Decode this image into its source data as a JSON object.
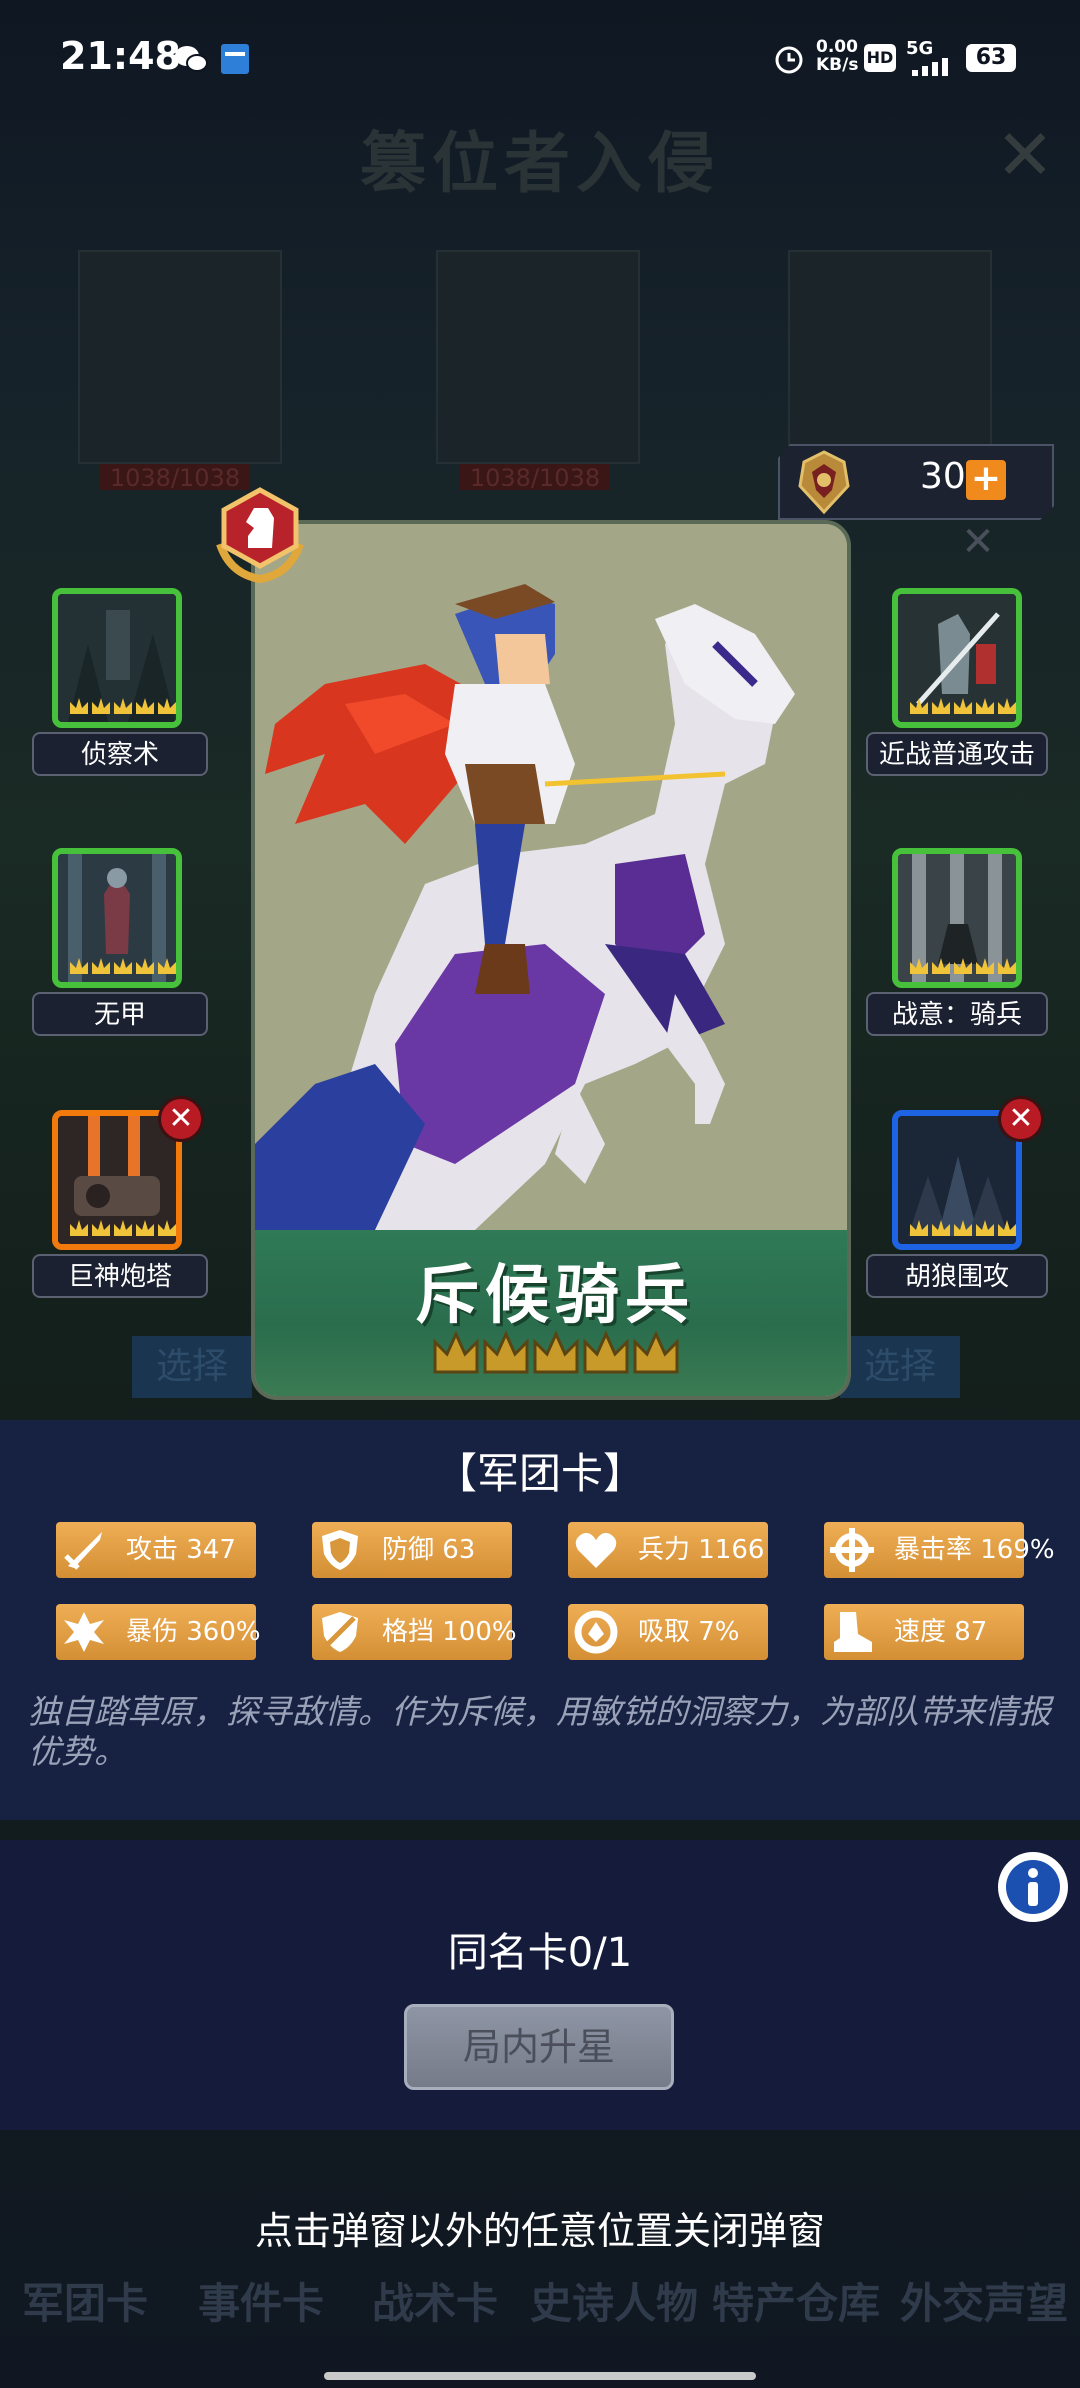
{
  "status_bar": {
    "time": "21:48",
    "net_speed_value": "0.00",
    "net_speed_unit": "KB/s",
    "hd_label": "HD",
    "network": "5G",
    "battery": "63"
  },
  "background": {
    "title": "篡位者入侵",
    "troop_hp_1": "1038/1038",
    "troop_hp_2": "1038/1038",
    "select_label": "选择",
    "hint_text": "点击弹窗以外的任意位置关闭弹窗",
    "bottom_tabs": [
      "军团卡",
      "事件卡",
      "战术卡",
      "史诗人物",
      "特产仓库",
      "外交声望"
    ]
  },
  "currency": {
    "amount": "30"
  },
  "card": {
    "name": "斥候骑兵",
    "stars": 5
  },
  "skills_left": [
    {
      "label": "侦察术",
      "frame": "green",
      "crowns": 5
    },
    {
      "label": "无甲",
      "frame": "green",
      "crowns": 5
    },
    {
      "label": "巨神炮塔",
      "frame": "orange",
      "crowns": 5
    }
  ],
  "skills_right": [
    {
      "label": "近战普通攻击",
      "frame": "green",
      "crowns": 5
    },
    {
      "label": "战意：骑兵",
      "frame": "green",
      "crowns": 5
    },
    {
      "label": "胡狼围攻",
      "frame": "blue",
      "crowns": 5
    }
  ],
  "panel": {
    "card_type": "【军团卡】",
    "stats": [
      {
        "icon": "sword-icon",
        "text": "攻击 347"
      },
      {
        "icon": "shield-icon",
        "text": "防御 63"
      },
      {
        "icon": "heart-icon",
        "text": "兵力 1166"
      },
      {
        "icon": "crosshair-icon",
        "text": "暴击率 169%"
      },
      {
        "icon": "burst-icon",
        "text": "暴伤 360%"
      },
      {
        "icon": "block-icon",
        "text": "格挡 100%"
      },
      {
        "icon": "drain-icon",
        "text": "吸取 7%"
      },
      {
        "icon": "boot-icon",
        "text": "速度 87"
      }
    ],
    "description": "独自踏草原，探寻敌情。作为斥候，用敏锐的洞察力，为部队带来情报优势。",
    "same_name": "同名卡0/1",
    "star_button": "局内升星",
    "close_hint": "点击弹窗以外的任意位置关闭弹窗"
  },
  "colors": {
    "panel_bg": "#182144",
    "stat_bg": "#e2a24a",
    "card_band": "#2f7a57",
    "frame_green": "#47c13b",
    "frame_orange": "#f27a0c",
    "frame_blue": "#1e63e3",
    "plus_orange": "#f08a1c"
  }
}
